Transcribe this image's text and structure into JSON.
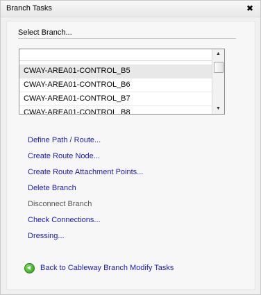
{
  "panel": {
    "title": "Branch Tasks",
    "close_glyph": "✖"
  },
  "select": {
    "label": "Select Branch...",
    "filter_value": "",
    "items": [
      "CWAY-AREA01-CONTROL_B5",
      "CWAY-AREA01-CONTROL_B6",
      "CWAY-AREA01-CONTROL_B7",
      "CWAY-AREA01-CONTROL_B8"
    ],
    "selected_index": 0,
    "scroll_up_glyph": "▲",
    "scroll_down_glyph": "▼"
  },
  "actions": [
    {
      "label": "Define Path / Route...",
      "enabled": true
    },
    {
      "label": "Create Route Node...",
      "enabled": true
    },
    {
      "label": "Create Route Attachment Points...",
      "enabled": true
    },
    {
      "label": "Delete Branch",
      "enabled": true
    },
    {
      "label": "Disconnect Branch",
      "enabled": false
    },
    {
      "label": "Check Connections...",
      "enabled": true
    },
    {
      "label": "Dressing...",
      "enabled": true
    }
  ],
  "back": {
    "label": "Back to Cableway Branch Modify Tasks",
    "icon": "green-back-arrow-icon"
  },
  "colors": {
    "link": "#1a1ab8",
    "disabled": "#555555",
    "panel_bg": "#f0f0f0"
  }
}
